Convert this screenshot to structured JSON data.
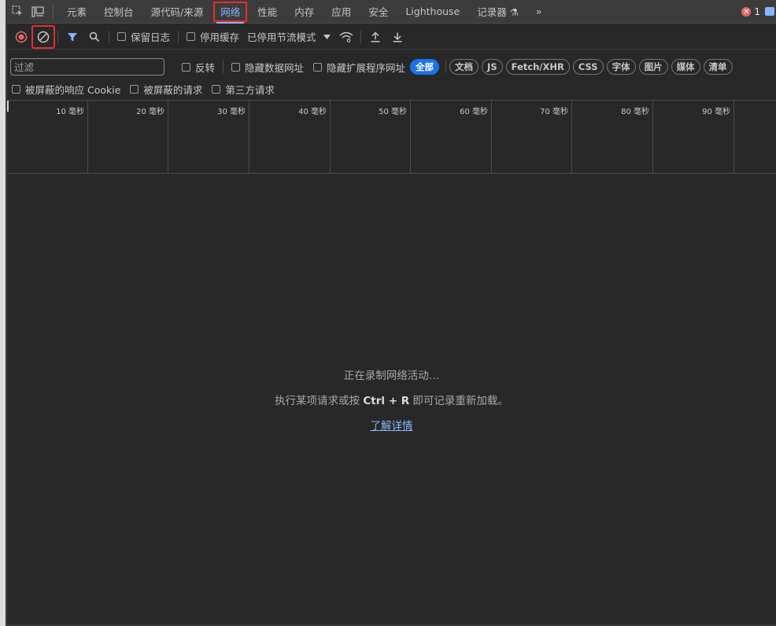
{
  "tabs": [
    {
      "label": "元素",
      "active": false
    },
    {
      "label": "控制台",
      "active": false
    },
    {
      "label": "源代码/来源",
      "active": false
    },
    {
      "label": "网络",
      "active": true
    },
    {
      "label": "性能",
      "active": false
    },
    {
      "label": "内存",
      "active": false
    },
    {
      "label": "应用",
      "active": false
    },
    {
      "label": "安全",
      "active": false
    },
    {
      "label": "Lighthouse",
      "active": false
    },
    {
      "label": "记录器 ⚗",
      "active": false
    }
  ],
  "more_tabs": "»",
  "error_count": "1",
  "toolbar": {
    "preserve_log": "保留日志",
    "disable_cache": "停用缓存",
    "throttling": "已停用节流模式"
  },
  "filter": {
    "placeholder": "过滤",
    "invert": "反转",
    "hide_data_urls": "隐藏数据网址",
    "hide_ext_urls": "隐藏扩展程序网址",
    "types": [
      "全部",
      "文档",
      "JS",
      "Fetch/XHR",
      "CSS",
      "字体",
      "图片",
      "媒体",
      "清单"
    ]
  },
  "blocked": {
    "blocked_cookies": "被屏蔽的响应 Cookie",
    "blocked_requests": "被屏蔽的请求",
    "third_party": "第三方请求"
  },
  "timeline_ticks": [
    "10 毫秒",
    "20 毫秒",
    "30 毫秒",
    "40 毫秒",
    "50 毫秒",
    "60 毫秒",
    "70 毫秒",
    "80 毫秒",
    "90 毫秒"
  ],
  "empty": {
    "recording": "正在录制网络活动…",
    "hint_prefix": "执行某项请求或按 ",
    "hint_key": "Ctrl + R",
    "hint_suffix": " 即可记录重新加载。",
    "learn_more": "了解详情"
  },
  "colors": {
    "accent": "#8ab4f8",
    "record": "#e46962",
    "highlight_box": "#e03030",
    "chip_selected": "#1a73e8"
  },
  "icons": [
    "inspect-icon",
    "device-toggle-icon",
    "record-stop-icon",
    "clear-icon",
    "filter-icon",
    "search-icon",
    "wifi-conditions-icon",
    "upload-icon",
    "download-icon",
    "error-icon",
    "message-icon"
  ]
}
